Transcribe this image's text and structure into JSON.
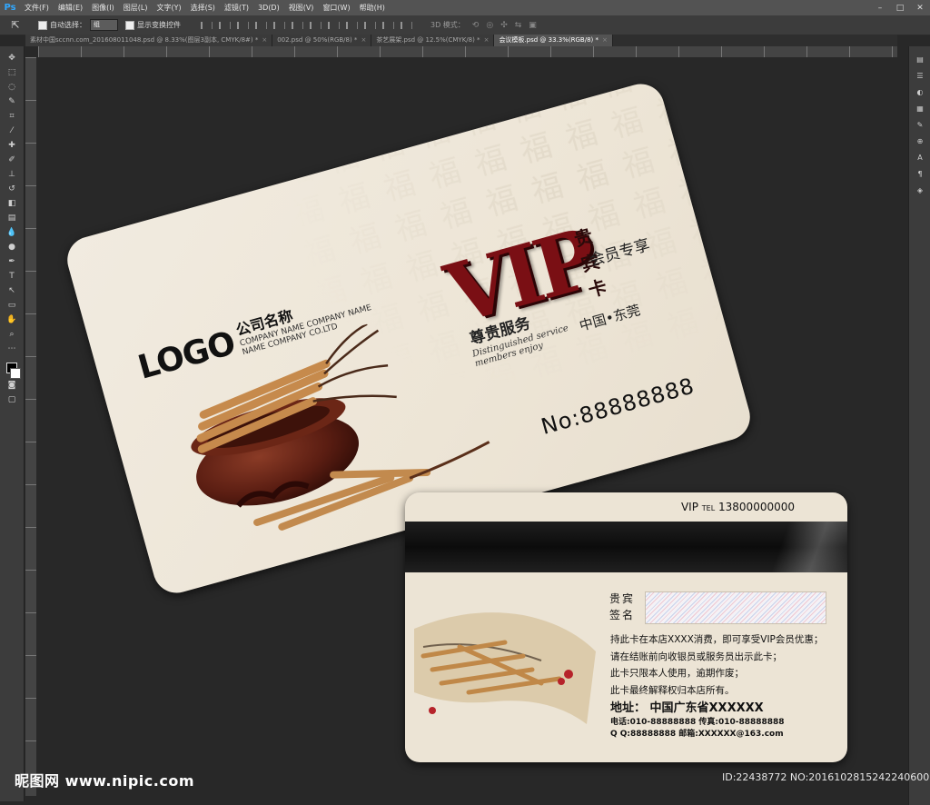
{
  "app": {
    "logo": "Ps"
  },
  "menu": [
    "文件(F)",
    "编辑(E)",
    "图像(I)",
    "图层(L)",
    "文字(Y)",
    "选择(S)",
    "滤镜(T)",
    "3D(D)",
    "视图(V)",
    "窗口(W)",
    "帮助(H)"
  ],
  "options": {
    "auto_select_label": "自动选择：",
    "auto_select_value": "组",
    "show_transform_label": "显示变换控件",
    "mode_3d_label": "3D 模式："
  },
  "tabs": [
    {
      "label": "素材中国sccnn.com_20160801104​8.psd @ 8.33%(图层3副本, CMYK/8#) *",
      "active": false
    },
    {
      "label": "002.psd @ 50%(RGB/8) *",
      "active": false
    },
    {
      "label": "茶艺展架.psd @ 12.5%(CMYK/8) *",
      "active": false
    },
    {
      "label": "会议模板.psd @ 33.3%(RGB/8) *",
      "active": true
    }
  ],
  "front_card": {
    "logo": "LOGO",
    "company_name": "公司名称",
    "company_en_line1": "COMPANY NAME COMPANY NAME",
    "company_en_line2": "NAME COMPANY CO.LTD",
    "vip": "VIP",
    "vip_card": "贵宾卡",
    "member_exclusive": "会员专享",
    "honor_service": "尊贵服务",
    "script_line1": "Distinguished service",
    "script_line2": "members enjoy",
    "location": "中国•东莞",
    "card_no": "No:88888888"
  },
  "back_card": {
    "tel_prefix": "VIP",
    "tel_label": "TEL",
    "tel_number": "13800000000",
    "sig_label_line1": "贵宾",
    "sig_label_line2": "签名",
    "terms": [
      "持此卡在本店XXXX消费，即可享受VIP会员优惠；",
      "请在结账前向收银员或服务员出示此卡；",
      "此卡只限本人使用，逾期作废；",
      "此卡最终解释权归本店所有。"
    ],
    "address": "地址：  中国广东省XXXXXX",
    "phone_line": "电话:010-88888888  传真:010-88888888",
    "qq_line": "Q Q:88888888  邮箱:XXXXXX@163.com"
  },
  "watermark": {
    "left": "昵图网 www.nipic.com",
    "right": "ID:22438772 NO:20161028152422406000"
  }
}
